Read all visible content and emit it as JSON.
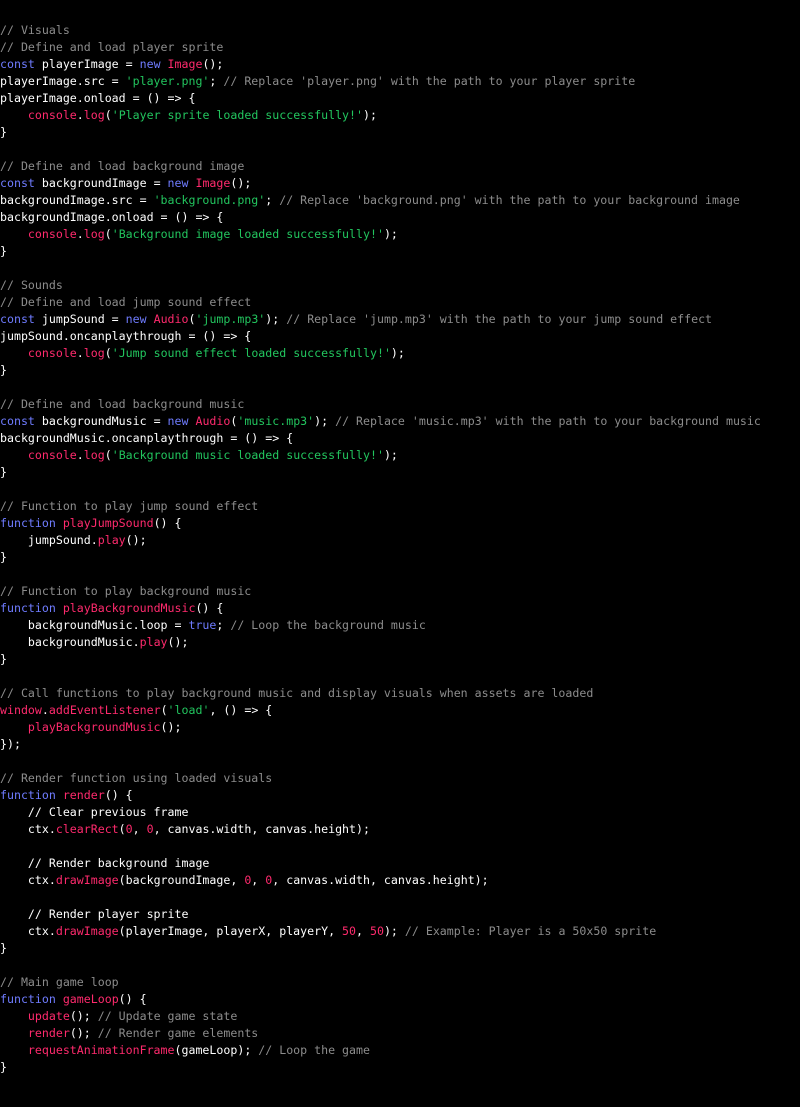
{
  "editor": {
    "colors": {
      "background": "#000000",
      "plain": "#ffffff",
      "comment": "#8c8c8c",
      "keyword": "#6f7cff",
      "string": "#22c55e",
      "function": "#ff2a6d",
      "number": "#ff2a6d"
    },
    "lines": [
      [
        {
          "t": "// Visuals",
          "k": "comment"
        }
      ],
      [
        {
          "t": "// Define and load player sprite",
          "k": "comment"
        }
      ],
      [
        {
          "t": "const",
          "k": "keyword"
        },
        {
          "t": " playerImage = ",
          "k": "plain"
        },
        {
          "t": "new",
          "k": "keyword"
        },
        {
          "t": " ",
          "k": "plain"
        },
        {
          "t": "Image",
          "k": "func"
        },
        {
          "t": "();",
          "k": "plain"
        }
      ],
      [
        {
          "t": "playerImage.src = ",
          "k": "plain"
        },
        {
          "t": "'player.png'",
          "k": "string"
        },
        {
          "t": "; ",
          "k": "plain"
        },
        {
          "t": "// Replace 'player.png' with the path to your player sprite",
          "k": "comment"
        }
      ],
      [
        {
          "t": "playerImage.onload = () => {",
          "k": "plain"
        }
      ],
      [
        {
          "t": "    ",
          "k": "plain"
        },
        {
          "t": "console",
          "k": "func"
        },
        {
          "t": ".",
          "k": "plain"
        },
        {
          "t": "log",
          "k": "func"
        },
        {
          "t": "(",
          "k": "plain"
        },
        {
          "t": "'Player sprite loaded successfully!'",
          "k": "string"
        },
        {
          "t": ");",
          "k": "plain"
        }
      ],
      [
        {
          "t": "}",
          "k": "plain"
        }
      ],
      [],
      [
        {
          "t": "// Define and load background image",
          "k": "comment"
        }
      ],
      [
        {
          "t": "const",
          "k": "keyword"
        },
        {
          "t": " backgroundImage = ",
          "k": "plain"
        },
        {
          "t": "new",
          "k": "keyword"
        },
        {
          "t": " ",
          "k": "plain"
        },
        {
          "t": "Image",
          "k": "func"
        },
        {
          "t": "();",
          "k": "plain"
        }
      ],
      [
        {
          "t": "backgroundImage.src = ",
          "k": "plain"
        },
        {
          "t": "'background.png'",
          "k": "string"
        },
        {
          "t": "; ",
          "k": "plain"
        },
        {
          "t": "// Replace 'background.png' with the path to your background image",
          "k": "comment"
        }
      ],
      [
        {
          "t": "backgroundImage.onload = () => {",
          "k": "plain"
        }
      ],
      [
        {
          "t": "    ",
          "k": "plain"
        },
        {
          "t": "console",
          "k": "func"
        },
        {
          "t": ".",
          "k": "plain"
        },
        {
          "t": "log",
          "k": "func"
        },
        {
          "t": "(",
          "k": "plain"
        },
        {
          "t": "'Background image loaded successfully!'",
          "k": "string"
        },
        {
          "t": ");",
          "k": "plain"
        }
      ],
      [
        {
          "t": "}",
          "k": "plain"
        }
      ],
      [],
      [
        {
          "t": "// Sounds",
          "k": "comment"
        }
      ],
      [
        {
          "t": "// Define and load jump sound effect",
          "k": "comment"
        }
      ],
      [
        {
          "t": "const",
          "k": "keyword"
        },
        {
          "t": " jumpSound = ",
          "k": "plain"
        },
        {
          "t": "new",
          "k": "keyword"
        },
        {
          "t": " ",
          "k": "plain"
        },
        {
          "t": "Audio",
          "k": "func"
        },
        {
          "t": "(",
          "k": "plain"
        },
        {
          "t": "'jump.mp3'",
          "k": "string"
        },
        {
          "t": "); ",
          "k": "plain"
        },
        {
          "t": "// Replace 'jump.mp3' with the path to your jump sound effect",
          "k": "comment"
        }
      ],
      [
        {
          "t": "jumpSound.oncanplaythrough = () => {",
          "k": "plain"
        }
      ],
      [
        {
          "t": "    ",
          "k": "plain"
        },
        {
          "t": "console",
          "k": "func"
        },
        {
          "t": ".",
          "k": "plain"
        },
        {
          "t": "log",
          "k": "func"
        },
        {
          "t": "(",
          "k": "plain"
        },
        {
          "t": "'Jump sound effect loaded successfully!'",
          "k": "string"
        },
        {
          "t": ");",
          "k": "plain"
        }
      ],
      [
        {
          "t": "}",
          "k": "plain"
        }
      ],
      [],
      [
        {
          "t": "// Define and load background music",
          "k": "comment"
        }
      ],
      [
        {
          "t": "const",
          "k": "keyword"
        },
        {
          "t": " backgroundMusic = ",
          "k": "plain"
        },
        {
          "t": "new",
          "k": "keyword"
        },
        {
          "t": " ",
          "k": "plain"
        },
        {
          "t": "Audio",
          "k": "func"
        },
        {
          "t": "(",
          "k": "plain"
        },
        {
          "t": "'music.mp3'",
          "k": "string"
        },
        {
          "t": "); ",
          "k": "plain"
        },
        {
          "t": "// Replace 'music.mp3' with the path to your background music",
          "k": "comment"
        }
      ],
      [
        {
          "t": "backgroundMusic.oncanplaythrough = () => {",
          "k": "plain"
        }
      ],
      [
        {
          "t": "    ",
          "k": "plain"
        },
        {
          "t": "console",
          "k": "func"
        },
        {
          "t": ".",
          "k": "plain"
        },
        {
          "t": "log",
          "k": "func"
        },
        {
          "t": "(",
          "k": "plain"
        },
        {
          "t": "'Background music loaded successfully!'",
          "k": "string"
        },
        {
          "t": ");",
          "k": "plain"
        }
      ],
      [
        {
          "t": "}",
          "k": "plain"
        }
      ],
      [],
      [
        {
          "t": "// Function to play jump sound effect",
          "k": "comment"
        }
      ],
      [
        {
          "t": "function",
          "k": "keyword"
        },
        {
          "t": " ",
          "k": "plain"
        },
        {
          "t": "playJumpSound",
          "k": "func"
        },
        {
          "t": "() {",
          "k": "plain"
        }
      ],
      [
        {
          "t": "    jumpSound.",
          "k": "plain"
        },
        {
          "t": "play",
          "k": "func"
        },
        {
          "t": "();",
          "k": "plain"
        }
      ],
      [
        {
          "t": "}",
          "k": "plain"
        }
      ],
      [],
      [
        {
          "t": "// Function to play background music",
          "k": "comment"
        }
      ],
      [
        {
          "t": "function",
          "k": "keyword"
        },
        {
          "t": " ",
          "k": "plain"
        },
        {
          "t": "playBackgroundMusic",
          "k": "func"
        },
        {
          "t": "() {",
          "k": "plain"
        }
      ],
      [
        {
          "t": "    backgroundMusic.loop = ",
          "k": "plain"
        },
        {
          "t": "true",
          "k": "keyword"
        },
        {
          "t": "; ",
          "k": "plain"
        },
        {
          "t": "// Loop the background music",
          "k": "comment"
        }
      ],
      [
        {
          "t": "    backgroundMusic.",
          "k": "plain"
        },
        {
          "t": "play",
          "k": "func"
        },
        {
          "t": "();",
          "k": "plain"
        }
      ],
      [
        {
          "t": "}",
          "k": "plain"
        }
      ],
      [],
      [
        {
          "t": "// Call functions to play background music and display visuals when assets are loaded",
          "k": "comment"
        }
      ],
      [
        {
          "t": "window",
          "k": "func"
        },
        {
          "t": ".",
          "k": "plain"
        },
        {
          "t": "addEventListener",
          "k": "func"
        },
        {
          "t": "(",
          "k": "plain"
        },
        {
          "t": "'load'",
          "k": "string"
        },
        {
          "t": ", () => {",
          "k": "plain"
        }
      ],
      [
        {
          "t": "    ",
          "k": "plain"
        },
        {
          "t": "playBackgroundMusic",
          "k": "func"
        },
        {
          "t": "();",
          "k": "plain"
        }
      ],
      [
        {
          "t": "});",
          "k": "plain"
        }
      ],
      [],
      [
        {
          "t": "// Render function using loaded visuals",
          "k": "comment"
        }
      ],
      [
        {
          "t": "function",
          "k": "keyword"
        },
        {
          "t": " ",
          "k": "plain"
        },
        {
          "t": "render",
          "k": "func"
        },
        {
          "t": "() {",
          "k": "plain"
        }
      ],
      [
        {
          "t": "    // Clear previous frame",
          "k": "plain"
        }
      ],
      [
        {
          "t": "    ctx.",
          "k": "plain"
        },
        {
          "t": "clearRect",
          "k": "func"
        },
        {
          "t": "(",
          "k": "plain"
        },
        {
          "t": "0",
          "k": "number"
        },
        {
          "t": ", ",
          "k": "plain"
        },
        {
          "t": "0",
          "k": "number"
        },
        {
          "t": ", canvas.width, canvas.height);",
          "k": "plain"
        }
      ],
      [],
      [
        {
          "t": "    // Render background image",
          "k": "plain"
        }
      ],
      [
        {
          "t": "    ctx.",
          "k": "plain"
        },
        {
          "t": "drawImage",
          "k": "func"
        },
        {
          "t": "(backgroundImage, ",
          "k": "plain"
        },
        {
          "t": "0",
          "k": "number"
        },
        {
          "t": ", ",
          "k": "plain"
        },
        {
          "t": "0",
          "k": "number"
        },
        {
          "t": ", canvas.width, canvas.height);",
          "k": "plain"
        }
      ],
      [],
      [
        {
          "t": "    // Render player sprite",
          "k": "plain"
        }
      ],
      [
        {
          "t": "    ctx.",
          "k": "plain"
        },
        {
          "t": "drawImage",
          "k": "func"
        },
        {
          "t": "(playerImage, playerX, playerY, ",
          "k": "plain"
        },
        {
          "t": "50",
          "k": "number"
        },
        {
          "t": ", ",
          "k": "plain"
        },
        {
          "t": "50",
          "k": "number"
        },
        {
          "t": "); ",
          "k": "plain"
        },
        {
          "t": "// Example: Player is a 50x50 sprite",
          "k": "comment"
        }
      ],
      [
        {
          "t": "}",
          "k": "plain"
        }
      ],
      [],
      [
        {
          "t": "// Main game loop",
          "k": "comment"
        }
      ],
      [
        {
          "t": "function",
          "k": "keyword"
        },
        {
          "t": " ",
          "k": "plain"
        },
        {
          "t": "gameLoop",
          "k": "func"
        },
        {
          "t": "() {",
          "k": "plain"
        }
      ],
      [
        {
          "t": "    ",
          "k": "plain"
        },
        {
          "t": "update",
          "k": "func"
        },
        {
          "t": "(); ",
          "k": "plain"
        },
        {
          "t": "// Update game state",
          "k": "comment"
        }
      ],
      [
        {
          "t": "    ",
          "k": "plain"
        },
        {
          "t": "render",
          "k": "func"
        },
        {
          "t": "(); ",
          "k": "plain"
        },
        {
          "t": "// Render game elements",
          "k": "comment"
        }
      ],
      [
        {
          "t": "    ",
          "k": "plain"
        },
        {
          "t": "requestAnimationFrame",
          "k": "func"
        },
        {
          "t": "(gameLoop); ",
          "k": "plain"
        },
        {
          "t": "// Loop the game",
          "k": "comment"
        }
      ],
      [
        {
          "t": "}",
          "k": "plain"
        }
      ]
    ]
  }
}
